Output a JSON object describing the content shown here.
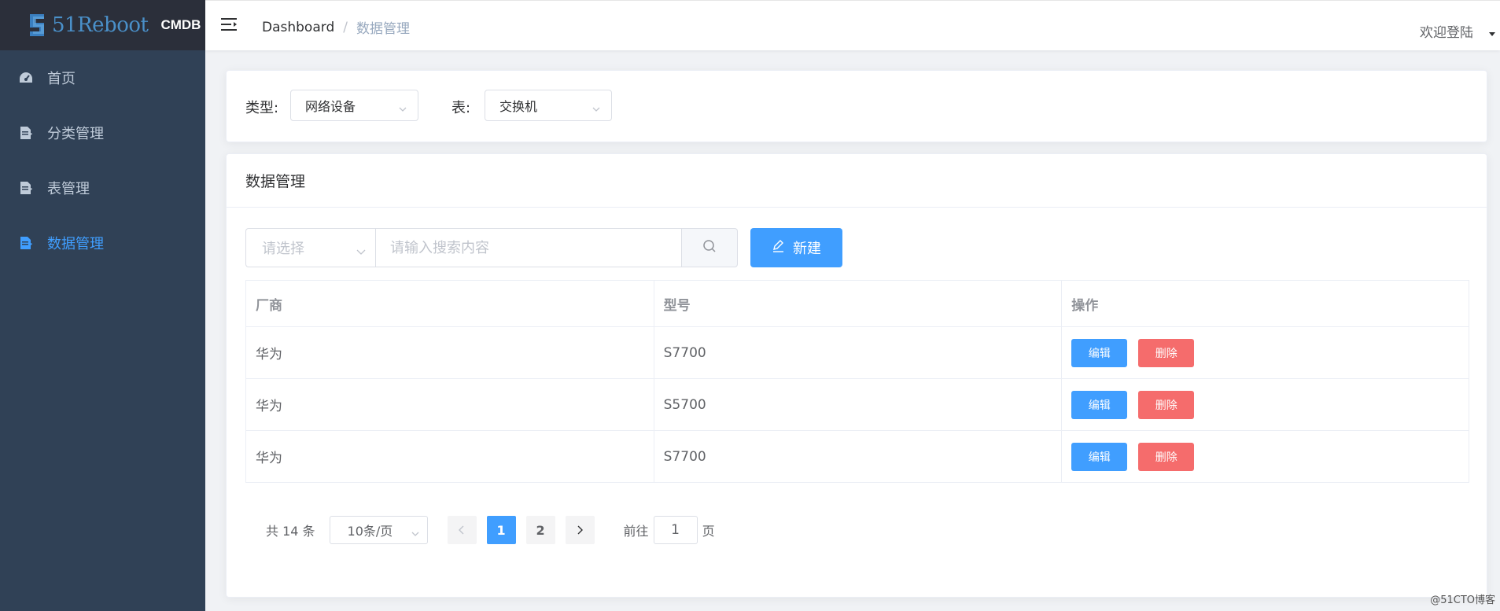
{
  "brand": {
    "logo_text": "51Reboot",
    "product": "CMDB",
    "logo_color": "#4a90c9"
  },
  "sidebar": {
    "items": [
      {
        "label": "首页",
        "icon": "dashboard-icon",
        "active": false
      },
      {
        "label": "分类管理",
        "icon": "document-icon",
        "active": false
      },
      {
        "label": "表管理",
        "icon": "document-icon",
        "active": false
      },
      {
        "label": "数据管理",
        "icon": "document-icon",
        "active": true
      }
    ]
  },
  "header": {
    "breadcrumb": [
      "Dashboard",
      "数据管理"
    ],
    "breadcrumb_separator": "/",
    "user_menu": "欢迎登陆"
  },
  "filters": {
    "type_label": "类型:",
    "type_value": "网络设备",
    "table_label": "表:",
    "table_value": "交换机"
  },
  "panel": {
    "title": "数据管理",
    "search_select_placeholder": "请选择",
    "search_placeholder": "请输入搜索内容",
    "new_button": "新建"
  },
  "table": {
    "columns": [
      "厂商",
      "型号",
      "操作"
    ],
    "rows": [
      {
        "vendor": "华为",
        "model": "S7700"
      },
      {
        "vendor": "华为",
        "model": "S5700"
      },
      {
        "vendor": "华为",
        "model": "S7700"
      }
    ],
    "edit_label": "编辑",
    "delete_label": "删除"
  },
  "pagination": {
    "total": "共 14 条",
    "page_size": "10条/页",
    "pages": [
      "1",
      "2"
    ],
    "current_page": "1",
    "goto_label": "前往",
    "goto_value": "1",
    "page_unit": "页"
  },
  "watermark": "@51CTO博客",
  "colors": {
    "primary": "#409eff",
    "danger": "#f56c6c",
    "sidebar_bg": "#304156",
    "logo_bg": "#2b2f3a"
  }
}
